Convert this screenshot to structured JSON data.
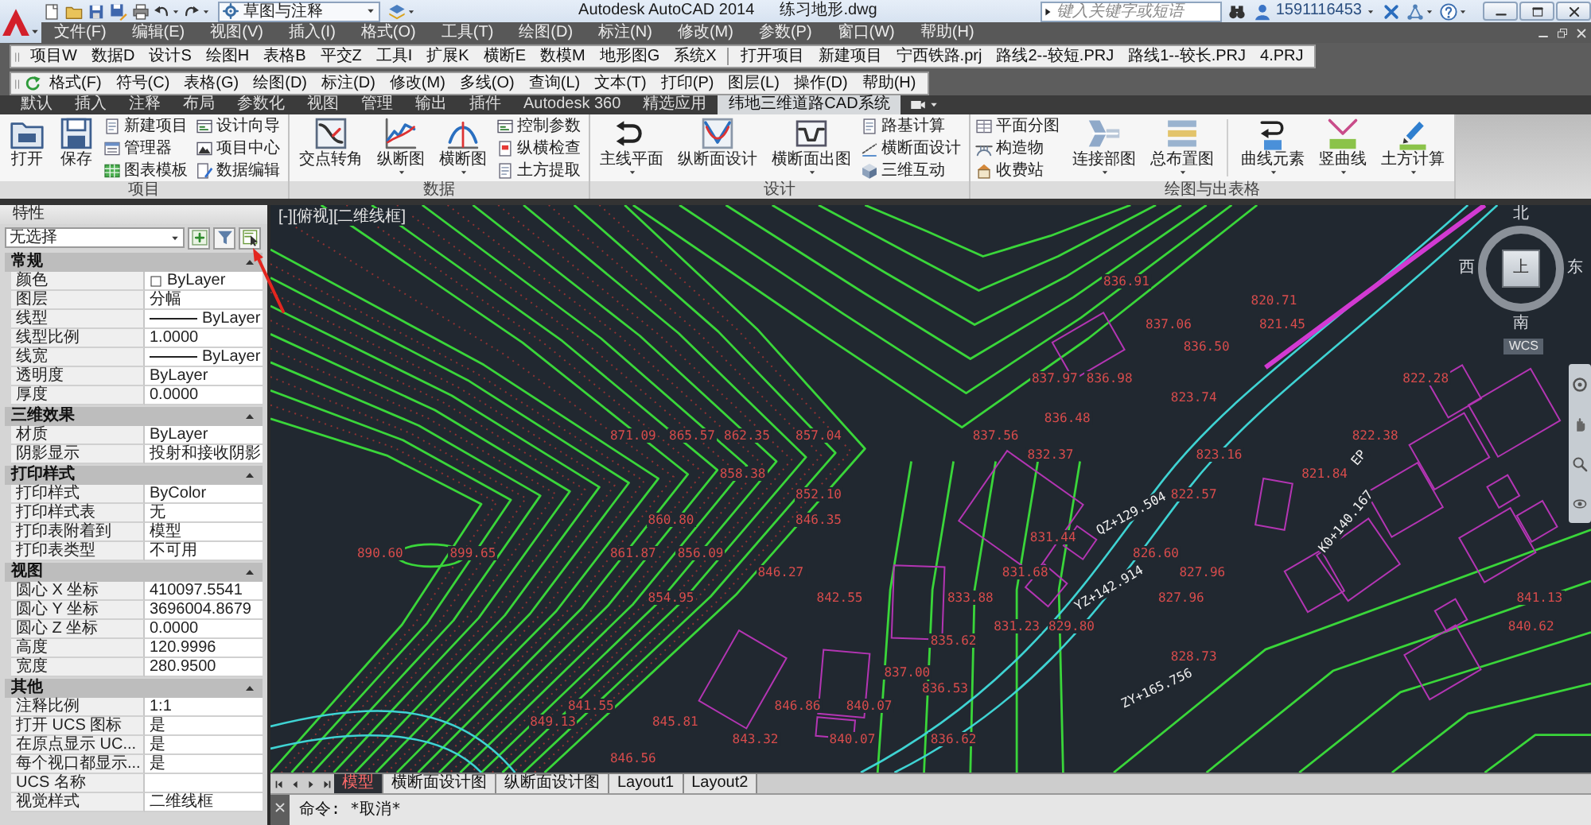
{
  "title_bar": {
    "workspace": "草图与注释",
    "app_title": "Autodesk AutoCAD 2014",
    "file_name": "练习地形.dwg",
    "search": {
      "placeholder": "键入关键字或短语"
    },
    "user": "1591116453"
  },
  "menu_bar": [
    "文件(F)",
    "编辑(E)",
    "视图(V)",
    "插入(I)",
    "格式(O)",
    "工具(T)",
    "绘图(D)",
    "标注(N)",
    "修改(M)",
    "参数(P)",
    "窗口(W)",
    "帮助(H)"
  ],
  "toolbar_1": {
    "menus": [
      "项目W",
      "数据D",
      "设计S",
      "绘图H",
      "表格B",
      "平交Z",
      "工具I",
      "扩展K",
      "横断E",
      "数模M",
      "地形图G",
      "系统X"
    ],
    "projects": [
      "打开项目",
      "新建项目",
      "宁西铁路.prj",
      "路线2--较短.PRJ",
      "路线1--较长.PRJ",
      "4.PRJ"
    ]
  },
  "toolbar_2": [
    "格式(F)",
    "符号(C)",
    "表格(G)",
    "绘图(D)",
    "标注(D)",
    "修改(M)",
    "多线(O)",
    "查询(L)",
    "文本(T)",
    "打印(P)",
    "图层(L)",
    "操作(D)",
    "帮助(H)"
  ],
  "ribbon": {
    "tabs": [
      {
        "label": "默认",
        "selected": false
      },
      {
        "label": "插入",
        "selected": false
      },
      {
        "label": "注释",
        "selected": false
      },
      {
        "label": "布局",
        "selected": false
      },
      {
        "label": "参数化",
        "selected": false
      },
      {
        "label": "视图",
        "selected": false
      },
      {
        "label": "管理",
        "selected": false
      },
      {
        "label": "输出",
        "selected": false
      },
      {
        "label": "插件",
        "selected": false
      },
      {
        "label": "Autodesk 360",
        "selected": false
      },
      {
        "label": "精选应用",
        "selected": false
      },
      {
        "label": "纬地三维道路CAD系统",
        "selected": true
      }
    ],
    "panels": [
      {
        "title": "项目",
        "buttons": [
          {
            "kind": "large",
            "label": "打开",
            "dropdown": false
          },
          {
            "kind": "large",
            "label": "保存",
            "dropdown": false
          },
          {
            "kind": "small",
            "label": "新建项目"
          },
          {
            "kind": "small",
            "label": "管理器"
          },
          {
            "kind": "small",
            "label": "图表模板"
          },
          {
            "kind": "small",
            "label": "设计向导"
          },
          {
            "kind": "small",
            "label": "项目中心"
          },
          {
            "kind": "small",
            "label": "数据编辑"
          }
        ]
      },
      {
        "title": "数据",
        "buttons": [
          {
            "kind": "large",
            "label": "交点转角",
            "dropdown": false
          },
          {
            "kind": "large",
            "label": "纵断图",
            "dropdown": true
          },
          {
            "kind": "large",
            "label": "横断图",
            "dropdown": true
          },
          {
            "kind": "small",
            "label": "控制参数"
          },
          {
            "kind": "small",
            "label": "纵横检查"
          },
          {
            "kind": "small",
            "label": "土方提取"
          }
        ]
      },
      {
        "title": "设计",
        "buttons": [
          {
            "kind": "large",
            "label": "主线平面",
            "dropdown": true
          },
          {
            "kind": "large",
            "label": "纵断面设计",
            "dropdown": false
          },
          {
            "kind": "large",
            "label": "横断面出图",
            "dropdown": true
          },
          {
            "kind": "small",
            "label": "路基计算"
          },
          {
            "kind": "small",
            "label": "横断面设计"
          },
          {
            "kind": "small",
            "label": "三维互动"
          }
        ]
      },
      {
        "title": "绘图与出表格",
        "buttons": [
          {
            "kind": "small",
            "label": "平面分图"
          },
          {
            "kind": "small",
            "label": "构造物"
          },
          {
            "kind": "small",
            "label": "收费站"
          },
          {
            "kind": "large",
            "label": "连接部图",
            "dropdown": true
          },
          {
            "kind": "large",
            "label": "总布置图",
            "dropdown": true
          },
          {
            "kind": "separator"
          },
          {
            "kind": "large",
            "label": "曲线元素",
            "dropdown": true
          },
          {
            "kind": "large",
            "label": "竖曲线",
            "dropdown": true
          },
          {
            "kind": "large",
            "label": "土方计算",
            "dropdown": true
          }
        ]
      }
    ]
  },
  "properties": {
    "title": "特性",
    "selection": "无选择",
    "sections": [
      {
        "title": "常规",
        "expanded": true,
        "rows": [
          {
            "kind": "color",
            "label": "颜色",
            "value": "ByLayer"
          },
          {
            "kind": "text",
            "label": "图层",
            "value": "分幅"
          },
          {
            "kind": "line",
            "label": "线型",
            "value": "ByLayer"
          },
          {
            "kind": "text",
            "label": "线型比例",
            "value": "1.0000"
          },
          {
            "kind": "line",
            "label": "线宽",
            "value": "ByLayer"
          },
          {
            "kind": "text",
            "label": "透明度",
            "value": "ByLayer"
          },
          {
            "kind": "text",
            "label": "厚度",
            "value": "0.0000"
          }
        ]
      },
      {
        "title": "三维效果",
        "expanded": true,
        "rows": [
          {
            "kind": "text",
            "label": "材质",
            "value": "ByLayer"
          },
          {
            "kind": "text",
            "label": "阴影显示",
            "value": "投射和接收阴影"
          }
        ]
      },
      {
        "title": "打印样式",
        "expanded": true,
        "rows": [
          {
            "kind": "text",
            "label": "打印样式",
            "value": "ByColor"
          },
          {
            "kind": "text",
            "label": "打印样式表",
            "value": "无"
          },
          {
            "kind": "text",
            "label": "打印表附着到",
            "value": "模型"
          },
          {
            "kind": "text",
            "label": "打印表类型",
            "value": "不可用"
          }
        ]
      },
      {
        "title": "视图",
        "expanded": true,
        "rows": [
          {
            "kind": "text",
            "label": "圆心 X 坐标",
            "value": "410097.5541"
          },
          {
            "kind": "text",
            "label": "圆心 Y 坐标",
            "value": "3696004.8679"
          },
          {
            "kind": "text",
            "label": "圆心 Z 坐标",
            "value": "0.0000"
          },
          {
            "kind": "text",
            "label": "高度",
            "value": "120.9996"
          },
          {
            "kind": "text",
            "label": "宽度",
            "value": "280.9500"
          }
        ]
      },
      {
        "title": "其他",
        "expanded": true,
        "rows": [
          {
            "kind": "text",
            "label": "注释比例",
            "value": "1:1"
          },
          {
            "kind": "text",
            "label": "打开 UCS 图标",
            "value": "是"
          },
          {
            "kind": "text",
            "label": "在原点显示 UC...",
            "value": "是"
          },
          {
            "kind": "text",
            "label": "每个视口都显示...",
            "value": "是"
          },
          {
            "kind": "text",
            "label": "UCS 名称"
          },
          {
            "kind": "text",
            "label": "视觉样式",
            "value": "二维线框"
          }
        ]
      }
    ]
  },
  "drawing": {
    "viewport_label": "[-][俯视][二维线框]",
    "elevation_labels": [
      "836.91",
      "820.71",
      "837.06",
      "821.45",
      "836.50",
      "837.97",
      "836.98",
      "822.28",
      "823.74",
      "836.48",
      "871.09",
      "865.57",
      "862.35",
      "857.04",
      "837.56",
      "822.38",
      "832.37",
      "823.16",
      "858.38",
      "821.84",
      "852.10",
      "822.57",
      "860.80",
      "846.35",
      "831.44",
      "890.60",
      "899.65",
      "861.87",
      "856.09",
      "826.60",
      "846.27",
      "831.68",
      "827.96",
      "854.95",
      "842.55",
      "833.88",
      "827.96",
      "841.13",
      "831.23",
      "829.80",
      "840.62",
      "835.62",
      "828.73",
      "837.00",
      "836.53",
      "841.55",
      "846.86",
      "840.07",
      "849.13",
      "845.81",
      "843.32",
      "840.07",
      "836.62",
      "846.56"
    ],
    "chainage_labels": [
      "EP",
      "QZ+129.504",
      "K0+140.167",
      "YZ+142.914",
      "ZY+165.756"
    ],
    "viewcube": {
      "face": "上",
      "north": "北",
      "south": "南",
      "west": "西",
      "east": "东",
      "ucs": "WCS"
    }
  },
  "layout_tabs": [
    {
      "label": "模型",
      "selected": true
    },
    {
      "label": "横断面设计图",
      "selected": false
    },
    {
      "label": "纵断面设计图",
      "selected": false
    },
    {
      "label": "Layout1",
      "selected": false
    },
    {
      "label": "Layout2",
      "selected": false
    }
  ],
  "command_line": {
    "text": "命令: *取消*"
  }
}
